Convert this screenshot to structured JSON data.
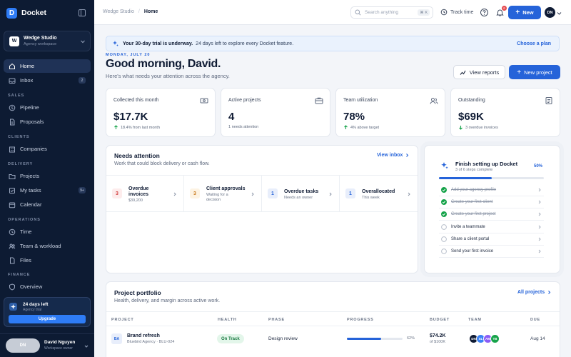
{
  "app": {
    "name": "Docket",
    "logo_letter": "D"
  },
  "workspace": {
    "name": "Wedge Studio",
    "subtitle": "Agency workspace",
    "initial": "W"
  },
  "nav": {
    "home": {
      "label": "Home",
      "icon": "home-icon"
    },
    "inbox": {
      "label": "Inbox",
      "count": "2",
      "icon": "inbox-icon"
    },
    "sections": {
      "sales": "SALES",
      "clients": "CLIENTS",
      "delivery": "DELIVERY",
      "operations": "OPERATIONS",
      "finance": "FINANCE"
    },
    "pipeline": {
      "label": "Pipeline"
    },
    "proposals": {
      "label": "Proposals"
    },
    "companies": {
      "label": "Companies"
    },
    "projects": {
      "label": "Projects"
    },
    "my_tasks": {
      "label": "My tasks",
      "count": "9+"
    },
    "calendar": {
      "label": "Calendar"
    },
    "time": {
      "label": "Time"
    },
    "team_workload": {
      "label": "Team & workload"
    },
    "files": {
      "label": "Files"
    },
    "overview": {
      "label": "Overview"
    }
  },
  "trial_card": {
    "title": "24 days left",
    "subtitle": "Agency trial",
    "button": "Upgrade"
  },
  "user": {
    "name": "David Nguyen",
    "role": "Workspace owner",
    "initials": "DN"
  },
  "topbar": {
    "breadcrumb_parent": "Wedge Studio",
    "breadcrumb_current": "Home",
    "search_placeholder": "Search anything",
    "search_shortcut": "⌘ K",
    "track_time": "Track time",
    "notification_count": "6",
    "new_button": "New",
    "avatar_initials": "DN"
  },
  "banner": {
    "title": "Your 30-day trial is underway.",
    "text": "24 days left to explore every Docket feature.",
    "action": "Choose a plan"
  },
  "header": {
    "date": "MONDAY, JULY 20",
    "greeting": "Good morning, David.",
    "subtitle": "Here's what needs your attention across the agency.",
    "view_reports": "View reports",
    "new_project": "New project"
  },
  "kpis": [
    {
      "label": "Collected this month",
      "value": "$17.7K",
      "note": "18.4% from last month",
      "trend": "up",
      "icon": "cash-icon"
    },
    {
      "label": "Active projects",
      "value": "4",
      "note": "1 needs attention",
      "trend": "none",
      "icon": "briefcase-icon"
    },
    {
      "label": "Team utilization",
      "value": "78%",
      "note": "4% above target",
      "trend": "up",
      "icon": "users-icon"
    },
    {
      "label": "Outstanding",
      "value": "$69K",
      "note": "3 overdue invoices",
      "trend": "down",
      "icon": "invoice-icon"
    }
  ],
  "attention": {
    "title": "Needs attention",
    "subtitle": "Work that could block delivery or cash flow.",
    "link": "View inbox",
    "items": [
      {
        "count": "3",
        "title_l1": "Overdue",
        "title_l2": "invoices",
        "sub_l1": "$39,200",
        "sub_l2": "",
        "tone": "red"
      },
      {
        "count": "3",
        "title_l1": "Client approvals",
        "title_l2": "",
        "sub_l1": "Waiting for a",
        "sub_l2": "decision",
        "tone": "amber"
      },
      {
        "count": "1",
        "title_l1": "Overdue tasks",
        "title_l2": "",
        "sub_l1": "Needs an owner",
        "sub_l2": "",
        "tone": "blue"
      },
      {
        "count": "1",
        "title_l1": "Overallocated",
        "title_l2": "",
        "sub_l1": "This week",
        "sub_l2": "",
        "tone": "blue"
      }
    ]
  },
  "setup": {
    "title": "Finish setting up Docket",
    "subtitle": "3 of 6 steps complete",
    "percent_label": "50%",
    "progress": 0.5,
    "steps": [
      {
        "label": "Add your agency profile",
        "done": true
      },
      {
        "label": "Create your first client",
        "done": true
      },
      {
        "label": "Create your first project",
        "done": true
      },
      {
        "label": "Invite a teammate",
        "done": false
      },
      {
        "label": "Share a client portal",
        "done": false
      },
      {
        "label": "Send your first invoice",
        "done": false
      }
    ]
  },
  "portfolio": {
    "title": "Project portfolio",
    "subtitle": "Health, delivery, and margin across active work.",
    "link": "All projects",
    "columns": {
      "project": "PROJECT",
      "health": "HEALTH",
      "phase": "PHASE",
      "progress": "PROGRESS",
      "budget": "BUDGET",
      "team": "TEAM",
      "due": "DUE"
    },
    "rows": [
      {
        "badge": "BA",
        "name": "Brand refresh",
        "client": "Bluebird Agency · BLU-024",
        "health": "On Track",
        "phase": "Design review",
        "progress": 0.62,
        "progress_label": "62%",
        "budget": "$74.2K",
        "budget_of": "of $100K",
        "team": [
          {
            "i": "DN",
            "c": "#0f1b34"
          },
          {
            "i": "SL",
            "c": "#3b82f6"
          },
          {
            "i": "AM",
            "c": "#8b5cf6"
          },
          {
            "i": "TB",
            "c": "#16a34a"
          }
        ],
        "due": "Aug 14"
      }
    ]
  },
  "colors": {
    "accent": "#2563d9",
    "sidebar": "#0d1b33"
  }
}
